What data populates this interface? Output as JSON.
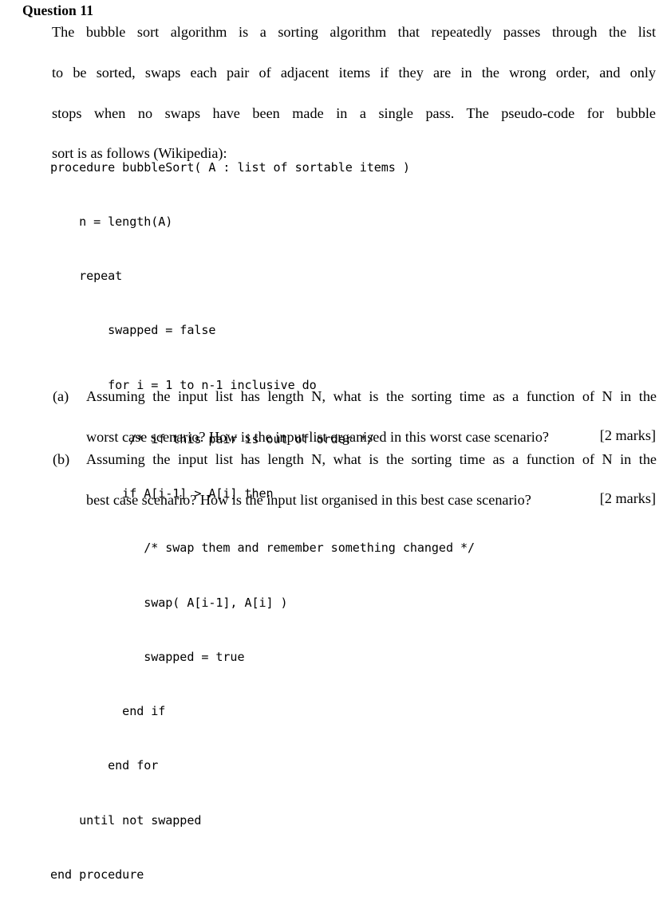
{
  "document": {
    "heading": "Question 11",
    "intro_lines": [
      "The bubble sort algorithm is a sorting algorithm that repeatedly passes through the list",
      "to be sorted, swaps each pair of adjacent items if they are in the wrong order, and only",
      "stops when no swaps have been made in a single pass.  The pseudo-code for bubble",
      "sort is as follows (Wikipedia):"
    ],
    "pseudocode": {
      "language": "pseudo-code",
      "lines": [
        "procedure bubbleSort( A : list of sortable items )",
        "    n = length(A)",
        "    repeat",
        "        swapped = false",
        "        for i = 1 to n-1 inclusive do",
        "           /* if this pair is out of order */",
        "          if A[i-1] > A[i] then",
        "             /* swap them and remember something changed */",
        "             swap( A[i-1], A[i] )",
        "             swapped = true",
        "          end if",
        "        end for",
        "    until not swapped",
        "end procedure"
      ]
    },
    "sub_questions": [
      {
        "marker": "(a)",
        "lines": [
          "Assuming the input list has length N, what is the sorting time as a function of N in the",
          "worst case scenario? How is the input list organised in this worst case scenario?"
        ],
        "marks": "[2 marks]"
      },
      {
        "marker": "(b)",
        "lines": [
          "Assuming the input list has length N, what is the sorting time as a function of N in the",
          "best case scenario? How is the input list organised in this best case scenario?"
        ],
        "marks": "[2 marks]"
      }
    ]
  }
}
